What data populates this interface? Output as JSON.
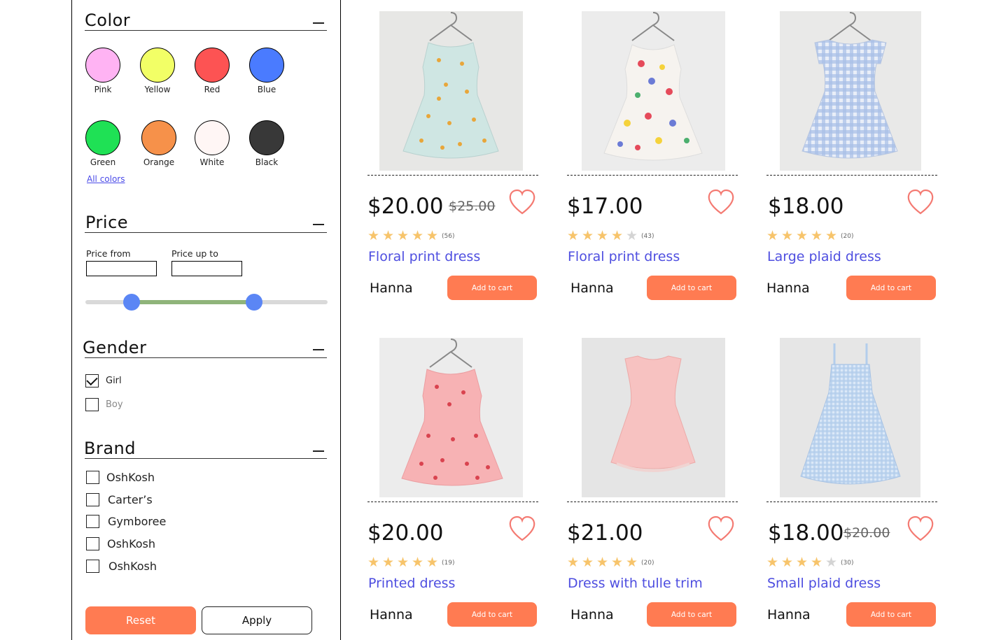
{
  "filters": {
    "color": {
      "title": "Color",
      "swatches": [
        {
          "label": "Pink",
          "color": "#ffb3f3"
        },
        {
          "label": "Yellow",
          "color": "#f2ff66"
        },
        {
          "label": "Red",
          "color": "#fd5353"
        },
        {
          "label": "Blue",
          "color": "#4a7bff"
        },
        {
          "label": "Green",
          "color": "#1fe155"
        },
        {
          "label": "Orange",
          "color": "#f6914a"
        },
        {
          "label": "White",
          "color": "#fff6f5"
        },
        {
          "label": "Black",
          "color": "#383838"
        }
      ],
      "all_colors": "All colors"
    },
    "price": {
      "title": "Price",
      "from_label": "Price from",
      "to_label": "Price up to",
      "from_value": "",
      "to_value": "",
      "range_low": 0.2,
      "range_high": 0.7
    },
    "gender": {
      "title": "Gender",
      "options": [
        {
          "label": "Girl",
          "checked": true
        },
        {
          "label": "Boy",
          "checked": false
        }
      ]
    },
    "brand": {
      "title": "Brand",
      "options": [
        {
          "label": "OshKosh",
          "checked": false
        },
        {
          "label": "Carter’s",
          "checked": false
        },
        {
          "label": "Gymboree",
          "checked": false
        },
        {
          "label": "OshKosh",
          "checked": false
        },
        {
          "label": "OshKosh",
          "checked": false
        }
      ]
    },
    "reset_label": "Reset",
    "apply_label": "Apply"
  },
  "products": [
    {
      "price": "$20.00",
      "old_price": "$25.00",
      "rating": 5,
      "reviews": "(56)",
      "name": "Floral print dress",
      "brand": "Hanna",
      "cart_label": "Add to cart"
    },
    {
      "price": "$17.00",
      "old_price": "",
      "rating": 4,
      "reviews": "(43)",
      "name": "Floral print dress",
      "brand": "Hanna",
      "cart_label": "Add to cart"
    },
    {
      "price": "$18.00",
      "old_price": "",
      "rating": 5,
      "reviews": "(20)",
      "name": "Large plaid dress",
      "brand": "Hanna",
      "cart_label": "Add to cart"
    },
    {
      "price": "$20.00",
      "old_price": "",
      "rating": 5,
      "reviews": "(19)",
      "name": "Printed dress",
      "brand": "Hanna",
      "cart_label": "Add to cart"
    },
    {
      "price": "$21.00",
      "old_price": "",
      "rating": 5,
      "reviews": "(20)",
      "name": "Dress with tulle trim",
      "brand": "Hanna",
      "cart_label": "Add to cart"
    },
    {
      "price": "$18.00",
      "old_price": "$20.00",
      "rating": 4,
      "reviews": "(30)",
      "name": "Small plaid dress",
      "brand": "Hanna",
      "cart_label": "Add to cart"
    }
  ],
  "colors": {
    "accent": "#ff7b52",
    "link": "#4e4ee0",
    "star": "#f7c46b",
    "heart": "#f47a72"
  }
}
